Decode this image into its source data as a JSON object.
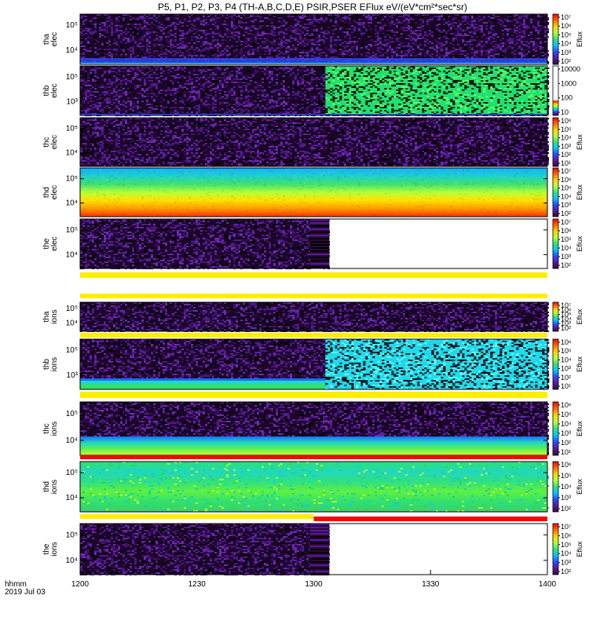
{
  "chart_data": {
    "type": "heatmap",
    "title": "P5, P1, P2, P3, P4 (TH-A,B,C,D,E) PSIR,PSER EFlux eV/(eV*cm²*sec*sr)",
    "xlabel_line1": "hhmm",
    "xlabel_line2": "2019 Jul 03",
    "x_ticks": [
      "1200",
      "1230",
      "1300",
      "1330",
      "1400"
    ],
    "x_tick_minutes": [
      0,
      30,
      60,
      90,
      120
    ],
    "xlim_minutes": [
      0,
      120
    ],
    "panels": [
      {
        "label_top": "tha",
        "label_bottom": "elec",
        "y_ticks": [
          "10⁵",
          "10⁴"
        ],
        "colorbar_ticks": [
          "10⁷",
          "10⁶",
          "10⁵",
          "10⁴",
          "10³",
          "10²"
        ],
        "colorbar_label": "Eflux",
        "colorbar_colored_to": 1.0
      },
      {
        "label_top": "thb",
        "label_bottom": "elec",
        "y_ticks": [
          "10⁵",
          "10³"
        ],
        "colorbar_ticks": [
          "10000",
          "1000",
          "100",
          "10"
        ],
        "colorbar_label": "",
        "colorbar_colored_to": 0.3
      },
      {
        "label_top": "thc",
        "label_bottom": "elec",
        "y_ticks": [
          "10⁵",
          "10⁴"
        ],
        "colorbar_ticks": [
          "10⁶",
          "10⁵",
          "10⁴",
          "10³",
          "10²",
          "10¹"
        ],
        "colorbar_label": "Eflux",
        "colorbar_colored_to": 1.0
      },
      {
        "label_top": "thd",
        "label_bottom": "elec",
        "y_ticks": [
          "10⁵",
          "10⁴"
        ],
        "colorbar_ticks": [
          "10⁷",
          "10⁶",
          "10⁵",
          "10⁴",
          "10³",
          "10²"
        ],
        "colorbar_label": "Eflux",
        "colorbar_colored_to": 1.0
      },
      {
        "label_top": "the",
        "label_bottom": "elec",
        "y_ticks": [
          "10⁵",
          "10⁴"
        ],
        "colorbar_ticks": [
          "10⁷",
          "10⁶",
          "10⁵",
          "10⁴",
          "10³",
          "10²"
        ],
        "colorbar_label": "Eflux",
        "colorbar_colored_to": 1.0,
        "data_end_minute": 64
      },
      {
        "label_top": "tha",
        "label_bottom": "ions",
        "y_ticks": [
          "10⁵",
          "10⁴"
        ],
        "colorbar_ticks": [
          "10⁷",
          "10⁶",
          "10⁵",
          "10⁴",
          "10³",
          "10²"
        ],
        "colorbar_label": "Eflux",
        "colorbar_colored_to": 1.0
      },
      {
        "label_top": "thb",
        "label_bottom": "ions",
        "y_ticks": [
          "10⁵",
          "10³"
        ],
        "colorbar_ticks": [
          "10⁶",
          "10⁵",
          "10⁴",
          "10³",
          "10²",
          "10¹"
        ],
        "colorbar_label": "Eflux",
        "colorbar_colored_to": 1.0
      },
      {
        "label_top": "thc",
        "label_bottom": "ions",
        "y_ticks": [
          "10⁵",
          "10⁴"
        ],
        "colorbar_ticks": [
          "10⁶",
          "10⁵",
          "10⁴",
          "10³",
          "10²",
          "10¹"
        ],
        "colorbar_label": "Eflux",
        "colorbar_colored_to": 1.0
      },
      {
        "label_top": "thd",
        "label_bottom": "ions",
        "y_ticks": [
          "10⁵",
          "10⁴"
        ],
        "colorbar_ticks": [
          "10⁶",
          "10⁵",
          "10⁴",
          "10³",
          "10²"
        ],
        "colorbar_label": "Eflux",
        "colorbar_colored_to": 1.0
      },
      {
        "label_top": "the",
        "label_bottom": "ions",
        "y_ticks": [
          "10⁵",
          "10⁴"
        ],
        "colorbar_ticks": [
          "10⁷",
          "10⁶",
          "10⁵",
          "10⁴",
          "10³",
          "10²"
        ],
        "colorbar_label": "Eflux",
        "colorbar_colored_to": 1.0,
        "data_end_minute": 64
      }
    ],
    "palette": [
      "#2b0b3f",
      "#5a189a",
      "#2b4cff",
      "#00c8ff",
      "#34e07a",
      "#b6ff3a",
      "#ffd400",
      "#ff6a00",
      "#ff0000"
    ]
  }
}
